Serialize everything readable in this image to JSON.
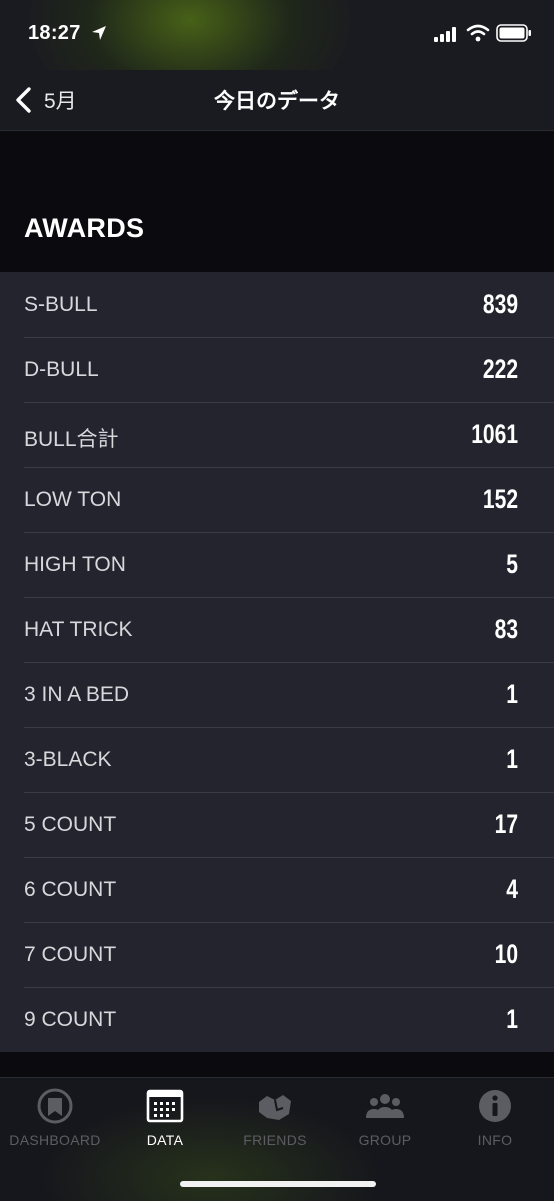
{
  "status_bar": {
    "time": "18:27"
  },
  "nav": {
    "back_label": "5月",
    "title": "今日のデータ"
  },
  "section": {
    "title": "AWARDS"
  },
  "awards": [
    {
      "label": "S-BULL",
      "value": "839"
    },
    {
      "label": "D-BULL",
      "value": "222"
    },
    {
      "label": "BULL合計",
      "value": "1061"
    },
    {
      "label": "LOW TON",
      "value": "152"
    },
    {
      "label": "HIGH TON",
      "value": "5"
    },
    {
      "label": "HAT TRICK",
      "value": "83"
    },
    {
      "label": "3 IN A BED",
      "value": "1"
    },
    {
      "label": "3-BLACK",
      "value": "1"
    },
    {
      "label": "5 COUNT",
      "value": "17"
    },
    {
      "label": "6 COUNT",
      "value": "4"
    },
    {
      "label": "7 COUNT",
      "value": "10"
    },
    {
      "label": "9 COUNT",
      "value": "1"
    }
  ],
  "tabs": [
    {
      "label": "DASHBOARD",
      "icon": "dashboard-icon",
      "active": false
    },
    {
      "label": "DATA",
      "icon": "data-icon",
      "active": true
    },
    {
      "label": "FRIENDS",
      "icon": "friends-icon",
      "active": false
    },
    {
      "label": "GROUP",
      "icon": "group-icon",
      "active": false
    },
    {
      "label": "INFO",
      "icon": "info-icon",
      "active": false
    }
  ],
  "colors": {
    "background": "#0b0b0f",
    "list_background": "#23242d",
    "tab_inactive": "#5c5d63",
    "tab_active": "#ffffff"
  }
}
